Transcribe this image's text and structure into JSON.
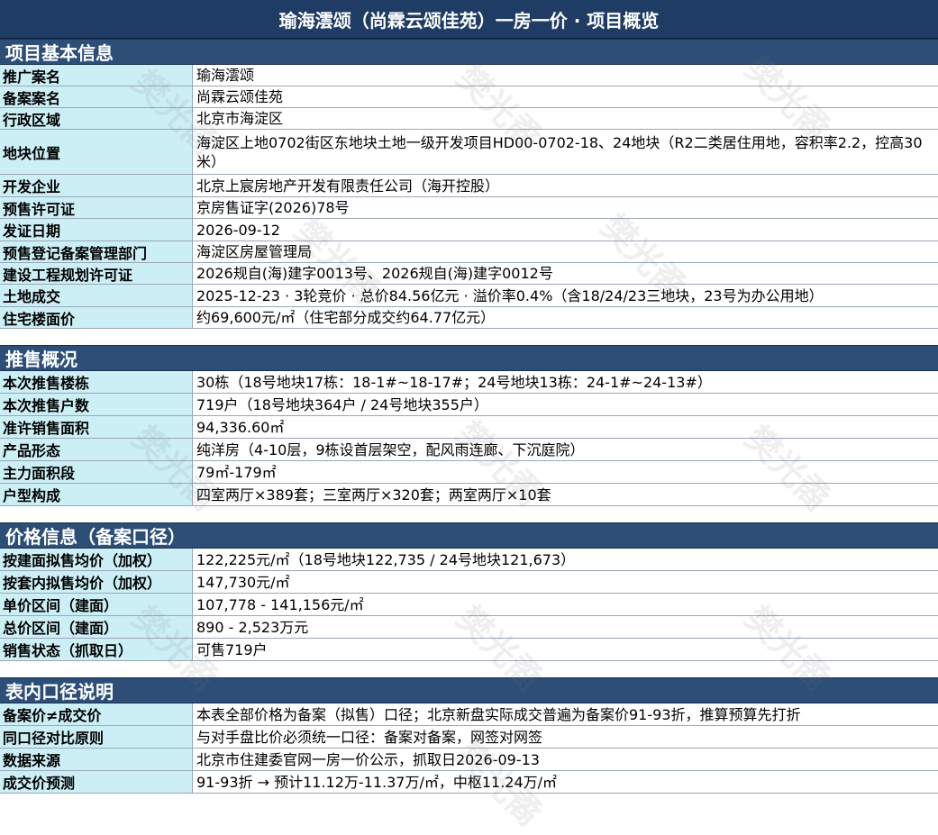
{
  "title": "瑜海澐颂（尚霖云颂佳苑）一房一价 · 项目概览",
  "sections": [
    {
      "heading": "项目基本信息",
      "rows": [
        {
          "k": "推广案名",
          "v": "瑜海澐颂"
        },
        {
          "k": "备案案名",
          "v": "尚霖云颂佳苑"
        },
        {
          "k": "行政区域",
          "v": "北京市海淀区"
        },
        {
          "k": "地块位置",
          "v": "海淀区上地0702街区东地块土地一级开发项目HD00-0702-18、24地块（R2二类居住用地，容积率2.2，控高30米）"
        },
        {
          "k": "开发企业",
          "v": "北京上宸房地产开发有限责任公司（海开控股）"
        },
        {
          "k": "预售许可证",
          "v": "京房售证字(2026)78号"
        },
        {
          "k": "发证日期",
          "v": "2026-09-12"
        },
        {
          "k": "预售登记备案管理部门",
          "v": "海淀区房屋管理局"
        },
        {
          "k": "建设工程规划许可证",
          "v": "2026规自(海)建字0013号、2026规自(海)建字0012号"
        },
        {
          "k": "土地成交",
          "v": "2025-12-23 · 3轮竞价 · 总价84.56亿元 · 溢价率0.4%（含18/24/23三地块，23号为办公用地）"
        },
        {
          "k": "住宅楼面价",
          "v": "约69,600元/㎡（住宅部分成交约64.77亿元）"
        }
      ]
    },
    {
      "heading": "推售概况",
      "rows": [
        {
          "k": "本次推售楼栋",
          "v": "30栋（18号地块17栋：18-1#~18-17#；24号地块13栋：24-1#~24-13#）"
        },
        {
          "k": "本次推售户数",
          "v": "719户（18号地块364户 / 24号地块355户）"
        },
        {
          "k": "准许销售面积",
          "v": "94,336.60㎡"
        },
        {
          "k": "产品形态",
          "v": "纯洋房（4-10层，9栋设首层架空，配风雨连廊、下沉庭院）"
        },
        {
          "k": "主力面积段",
          "v": "79㎡-179㎡"
        },
        {
          "k": "户型构成",
          "v": "四室两厅×389套；三室两厅×320套；两室两厅×10套"
        }
      ]
    },
    {
      "heading": "价格信息（备案口径）",
      "rows": [
        {
          "k": "按建面拟售均价（加权）",
          "v": "122,225元/㎡（18号地块122,735 / 24号地块121,673）"
        },
        {
          "k": "按套内拟售均价（加权）",
          "v": "147,730元/㎡"
        },
        {
          "k": "单价区间（建面）",
          "v": "107,778 - 141,156元/㎡"
        },
        {
          "k": "总价区间（建面）",
          "v": "890 - 2,523万元"
        },
        {
          "k": "销售状态（抓取日）",
          "v": "可售719户"
        }
      ]
    },
    {
      "heading": "表内口径说明",
      "rows": [
        {
          "k": "备案价≠成交价",
          "v": "本表全部价格为备案（拟售）口径；北京新盘实际成交普遍为备案价91-93折，推算预算先打折"
        },
        {
          "k": "同口径对比原则",
          "v": "与对手盘比价必须统一口径：备案对备案，网签对网签"
        },
        {
          "k": "数据来源",
          "v": "北京市住建委官网一房一价公示，抓取日2026-09-13"
        },
        {
          "k": "成交价预测",
          "v": "91-93折 → 预计11.12万-11.37万/㎡，中枢11.24万/㎡"
        }
      ]
    }
  ],
  "watermark": "樊光矞"
}
